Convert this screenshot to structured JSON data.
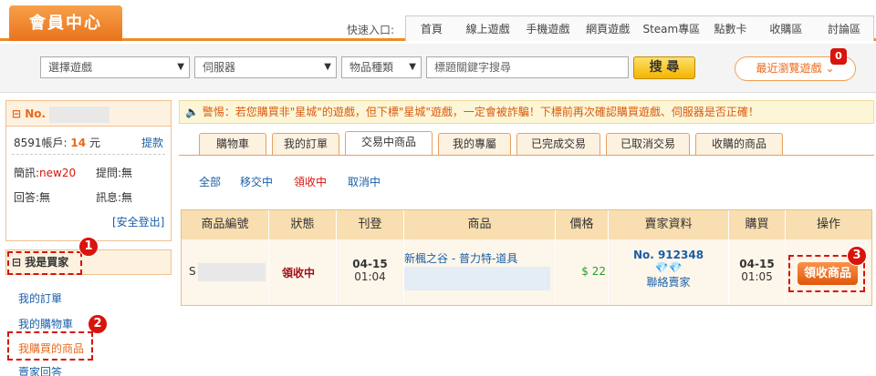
{
  "header": {
    "logo": "會員中心",
    "quick_label": "快速入口:",
    "quick_links": [
      "首頁",
      "線上遊戲",
      "手機遊戲",
      "網頁遊戲",
      "Steam專區",
      "點數卡",
      "收購區",
      "討論區"
    ]
  },
  "search": {
    "game_select": "選擇遊戲",
    "server_select": "伺服器",
    "category_select": "物品種類",
    "keyword_placeholder": "標題關鍵字搜尋",
    "search_button": "搜 尋",
    "recent_button": "最近瀏覽遊戲",
    "recent_count": "0"
  },
  "sidebar": {
    "user_no_prefix": "No.",
    "account_label": "8591帳戶:",
    "account_amount": "14",
    "account_unit": "元",
    "withdraw_link": "提款",
    "brief_label": "簡訊:",
    "brief_value": "new20",
    "questions_label": "提問:",
    "questions_value": "無",
    "answers_label": "回答:",
    "answers_value": "無",
    "messages_label": "訊息:",
    "messages_value": "無",
    "logout_link": "[安全登出]",
    "buyer_section": "我是買家",
    "buyer_links": [
      "我的訂單",
      "我的購物車",
      "我購買的商品",
      "賣家回答"
    ]
  },
  "notice": "警惕：若您購買非\"星城\"的遊戲，但下標\"星城\"遊戲，一定會被詐騙！下標前再次確認購買遊戲、伺服器是否正確！",
  "tabs": [
    "購物車",
    "我的訂單",
    "交易中商品",
    "我的專屬",
    "已完成交易",
    "已取消交易",
    "收購的商品"
  ],
  "active_tab": "交易中商品",
  "subnav": [
    "全部",
    "移交中",
    "領收中",
    "取消中"
  ],
  "table": {
    "headers": [
      "商品編號",
      "狀態",
      "刊登",
      "商品",
      "價格",
      "賣家資料",
      "購買",
      "操作"
    ],
    "row": {
      "id_prefix": "S",
      "status": "領收中",
      "listed_date": "04-15",
      "listed_time": "01:04",
      "product_line1": "新楓之谷 - 普力特-道具",
      "price": "$ 22",
      "seller_no": "No. 912348",
      "seller_contact": "聯絡賣家",
      "buy_date": "04-15",
      "buy_time": "01:05",
      "action_button": "領收商品"
    }
  },
  "annotations": [
    "1",
    "2",
    "3"
  ]
}
